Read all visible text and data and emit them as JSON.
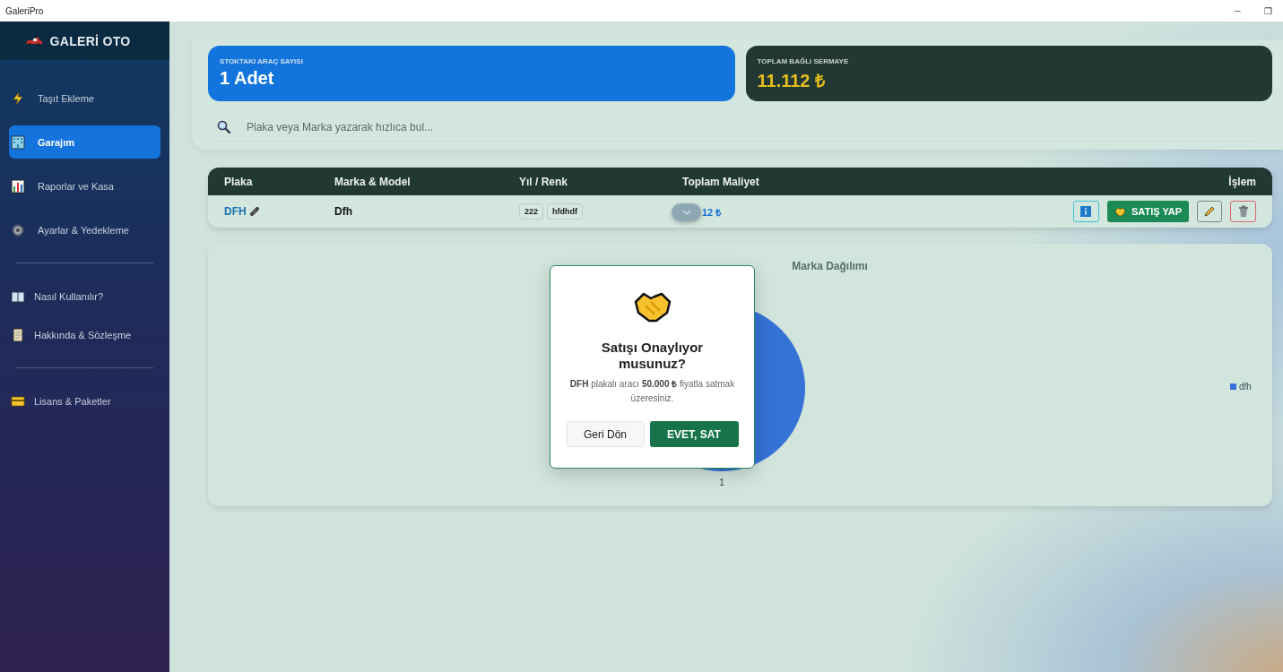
{
  "window": {
    "title": "GaleriPro",
    "controls": [
      "─",
      "❐"
    ]
  },
  "sidebar": {
    "brand": "GALERİ OTO",
    "items": [
      {
        "label": "Taşıt Ekleme",
        "selected": false
      },
      {
        "label": "Garajım",
        "selected": true
      },
      {
        "label": "Raporlar ve Kasa",
        "selected": false
      },
      {
        "label": "Ayarlar & Yedekleme",
        "selected": false
      },
      {
        "label": "Nasıl Kullanılır?",
        "selected": false
      },
      {
        "label": "Hakkında & Sözleşme",
        "selected": false
      },
      {
        "label": "Lisans & Paketler",
        "selected": false
      }
    ]
  },
  "stats": [
    {
      "label": "STOKTAKI ARAÇ SAYISI",
      "value": "1 Adet",
      "kind": "primary"
    },
    {
      "label": "TOPLAM BAĞLI SERMAYE",
      "value": "11.112 ₺",
      "kind": "dark"
    }
  ],
  "search": {
    "placeholder": "Plaka veya Marka yazarak hızlıca bul..."
  },
  "table": {
    "columns": [
      "Plaka",
      "Marka & Model",
      "Yıl / Renk",
      "Toplam Maliyet",
      "İşlem"
    ],
    "rows": [
      {
        "plate": "DFH",
        "model": "Dfh",
        "year": "222",
        "color_name": "hfdhdf",
        "cost": "12 ₺",
        "sell_label": "SATIŞ YAP"
      }
    ]
  },
  "chart": {
    "title": "Marka Dağılımı",
    "chart_data": {
      "type": "pie",
      "categories": [
        "dfh"
      ],
      "series": [
        {
          "color": "#3572d6",
          "values": [
            1
          ]
        }
      ],
      "data_labels": true
    }
  },
  "dialog": {
    "title": "Satışı Onaylıyor musunuz?",
    "message": "**DFH** plakalı aracı **50.000 ₺** fiyatla satmak üzeresiniz.",
    "cancel": "Geri Dön",
    "confirm": "EVET, SAT"
  }
}
